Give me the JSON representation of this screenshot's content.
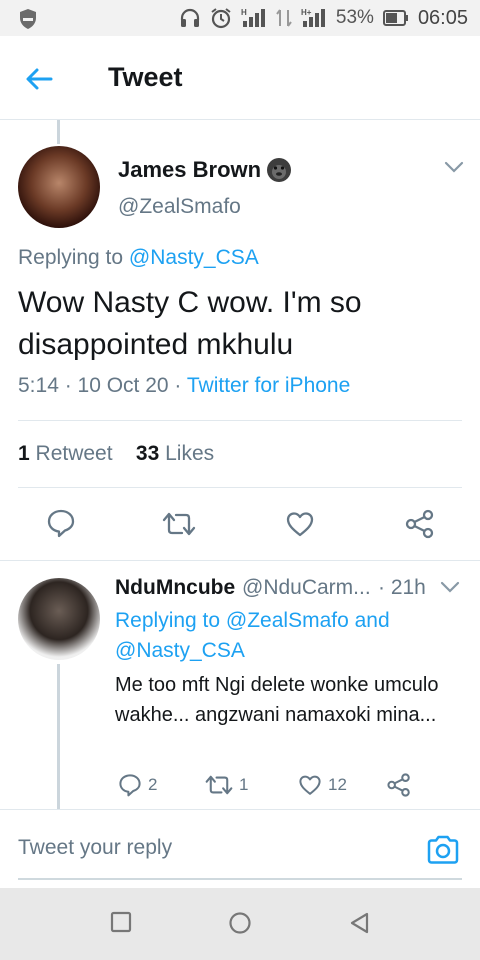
{
  "status_bar": {
    "battery": "53%",
    "time": "06:05"
  },
  "header": {
    "title": "Tweet"
  },
  "tweet": {
    "author_name": "James Brown",
    "author_handle": "@ZealSmafo",
    "replying_prefix": "Replying to ",
    "replying_to": "@Nasty_CSA",
    "text": "Wow Nasty C wow. I'm so disappointed mkhulu",
    "time": "5:14 · 10 Oct 20 · ",
    "source": "Twitter for iPhone",
    "retweets_count": "1",
    "retweets_label": "Retweet",
    "likes_count": "33",
    "likes_label": "Likes"
  },
  "reply": {
    "author_name": "NduMncube",
    "author_handle": "@NduCarm...",
    "time": "· 21h",
    "replying_text": "Replying to @ZealSmafo and @Nasty_CSA",
    "text": "Me too mft Ngi delete wonke umculo wakhe... angzwani namaxoki mina...",
    "reply_count": "2",
    "retweet_count": "1",
    "like_count": "12"
  },
  "compose": {
    "placeholder": "Tweet your reply"
  },
  "colors": {
    "accent": "#1da1f2",
    "secondary_text": "#657786",
    "primary_text": "#14171a"
  }
}
